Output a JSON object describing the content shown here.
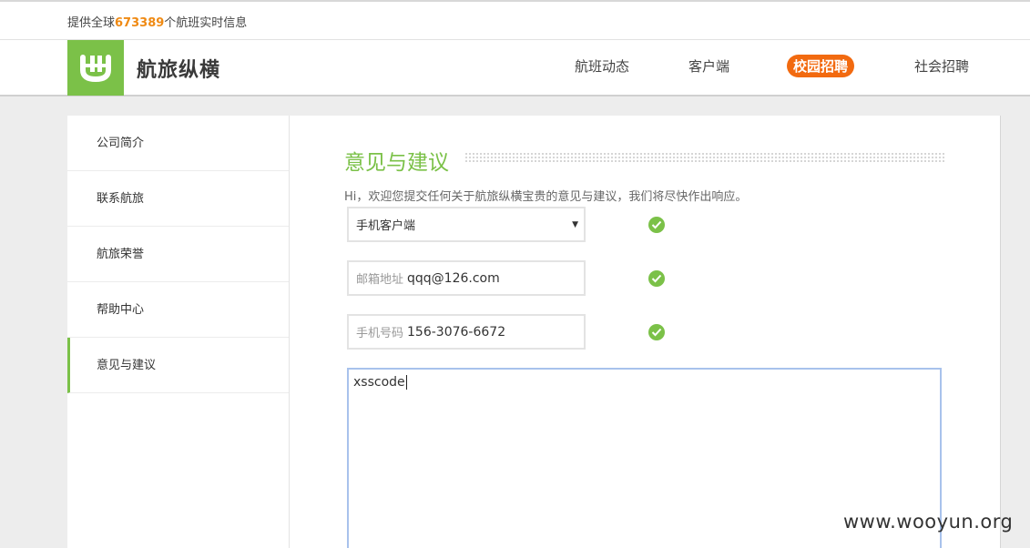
{
  "topbar": {
    "tagline_prefix": "提供全球",
    "flight_count": "673389",
    "tagline_suffix": "个航班实时信息"
  },
  "header": {
    "brand": "航旅纵横",
    "nav": [
      {
        "label": "航班动态",
        "active": false
      },
      {
        "label": "客户端",
        "active": false
      },
      {
        "label": "校园招聘",
        "active": true
      },
      {
        "label": "社会招聘",
        "active": false
      }
    ]
  },
  "sidebar": {
    "items": [
      {
        "label": "公司简介",
        "active": false
      },
      {
        "label": "联系航旅",
        "active": false
      },
      {
        "label": "航旅荣誉",
        "active": false
      },
      {
        "label": "帮助中心",
        "active": false
      },
      {
        "label": "意见与建议",
        "active": true
      }
    ]
  },
  "feedback": {
    "title": "意见与建议",
    "intro": "Hi，欢迎您提交任何关于航旅纵横宝贵的意见与建议，我们将尽快作出响应。",
    "category_select": {
      "value": "手机客户端"
    },
    "email": {
      "label": "邮箱地址",
      "value": "qqq@126.com"
    },
    "phone": {
      "label": "手机号码",
      "value": "156-3076-6672"
    },
    "message": {
      "value": "xsscode"
    }
  },
  "watermark": "www.wooyun.org",
  "colors": {
    "brand_green": "#7bc148",
    "accent_orange": "#f26a10",
    "count_orange": "#ef8a14"
  }
}
